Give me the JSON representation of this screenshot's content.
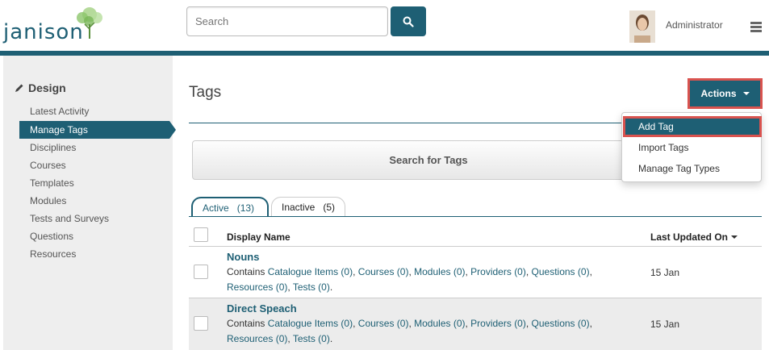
{
  "header": {
    "logo_text": "janison",
    "search_placeholder": "Search",
    "user_name": "Administrator"
  },
  "sidebar": {
    "section_title": "Design",
    "items": [
      {
        "label": "Latest Activity"
      },
      {
        "label": "Manage Tags"
      },
      {
        "label": "Disciplines"
      },
      {
        "label": "Courses"
      },
      {
        "label": "Templates"
      },
      {
        "label": "Modules"
      },
      {
        "label": "Tests and Surveys"
      },
      {
        "label": "Questions"
      },
      {
        "label": "Resources"
      }
    ],
    "active_index": 1
  },
  "main": {
    "title": "Tags",
    "actions_label": "Actions",
    "actions_menu": [
      "Add Tag",
      "Import Tags",
      "Manage Tag Types"
    ],
    "search_for_tags": "Search for Tags",
    "tabs": [
      {
        "label": "Active",
        "count": "(13)"
      },
      {
        "label": "Inactive",
        "count": "(5)"
      }
    ],
    "columns": {
      "display_name": "Display Name",
      "last_updated": "Last Updated On"
    },
    "rows": [
      {
        "name": "Nouns",
        "contains_prefix": "Contains",
        "links": [
          "Catalogue Items (0)",
          "Courses (0)",
          "Modules (0)",
          "Providers (0)",
          "Questions (0)",
          "Resources (0)",
          "Tests (0)"
        ],
        "date": "15 Jan"
      },
      {
        "name": "Direct Speach",
        "contains_prefix": "Contains",
        "links": [
          "Catalogue Items (0)",
          "Courses (0)",
          "Modules (0)",
          "Providers (0)",
          "Questions (0)",
          "Resources (0)",
          "Tests (0)"
        ],
        "date": "15 Jan"
      }
    ]
  },
  "colors": {
    "accent": "#1e5f74",
    "highlight_border": "#d9534f"
  }
}
